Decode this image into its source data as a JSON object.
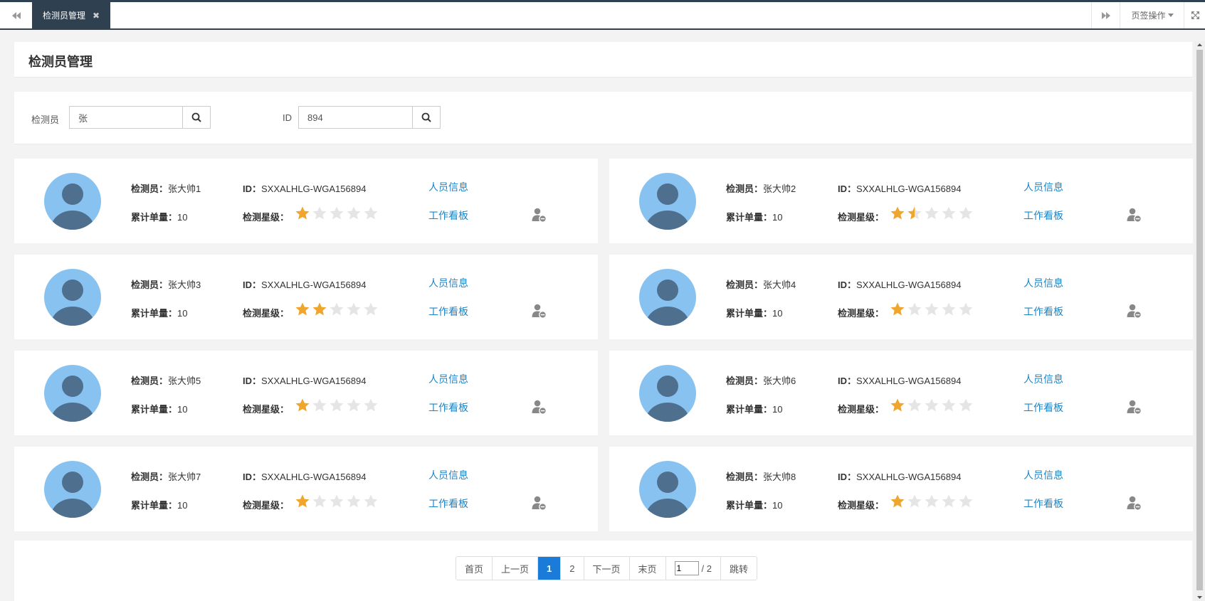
{
  "tabs": {
    "active_label": "检测员管理",
    "close_glyph": "✖",
    "page_ops_label": "页签操作"
  },
  "page": {
    "title": "检测员管理"
  },
  "search": {
    "inspector_label": "检测员",
    "inspector_value": "张",
    "id_label": "ID",
    "id_value": "894"
  },
  "labels": {
    "inspector": "检测员：",
    "id": "ID：",
    "orders": "累计单量：",
    "rating": "检测星级：",
    "info_link": "人员信息",
    "board_link": "工作看板"
  },
  "colors": {
    "star_on": "#f0a62c",
    "star_off": "#e5e5e5",
    "link": "#1c84c6",
    "accent": "#1a7bd8"
  },
  "inspectors": [
    {
      "name": "张大帅1",
      "id": "SXXALHLG-WGA156894",
      "orders": "10",
      "rating": 1
    },
    {
      "name": "张大帅2",
      "id": "SXXALHLG-WGA156894",
      "orders": "10",
      "rating": 1.5
    },
    {
      "name": "张大帅3",
      "id": "SXXALHLG-WGA156894",
      "orders": "10",
      "rating": 2
    },
    {
      "name": "张大帅4",
      "id": "SXXALHLG-WGA156894",
      "orders": "10",
      "rating": 1
    },
    {
      "name": "张大帅5",
      "id": "SXXALHLG-WGA156894",
      "orders": "10",
      "rating": 1
    },
    {
      "name": "张大帅6",
      "id": "SXXALHLG-WGA156894",
      "orders": "10",
      "rating": 1
    },
    {
      "name": "张大帅7",
      "id": "SXXALHLG-WGA156894",
      "orders": "10",
      "rating": 1
    },
    {
      "name": "张大帅8",
      "id": "SXXALHLG-WGA156894",
      "orders": "10",
      "rating": 1
    }
  ],
  "pagination": {
    "first": "首页",
    "prev": "上一页",
    "current": "1",
    "next_page_num": "2",
    "next": "下一页",
    "last": "末页",
    "input_value": "1",
    "total": "/ 2",
    "jump": "跳转"
  }
}
